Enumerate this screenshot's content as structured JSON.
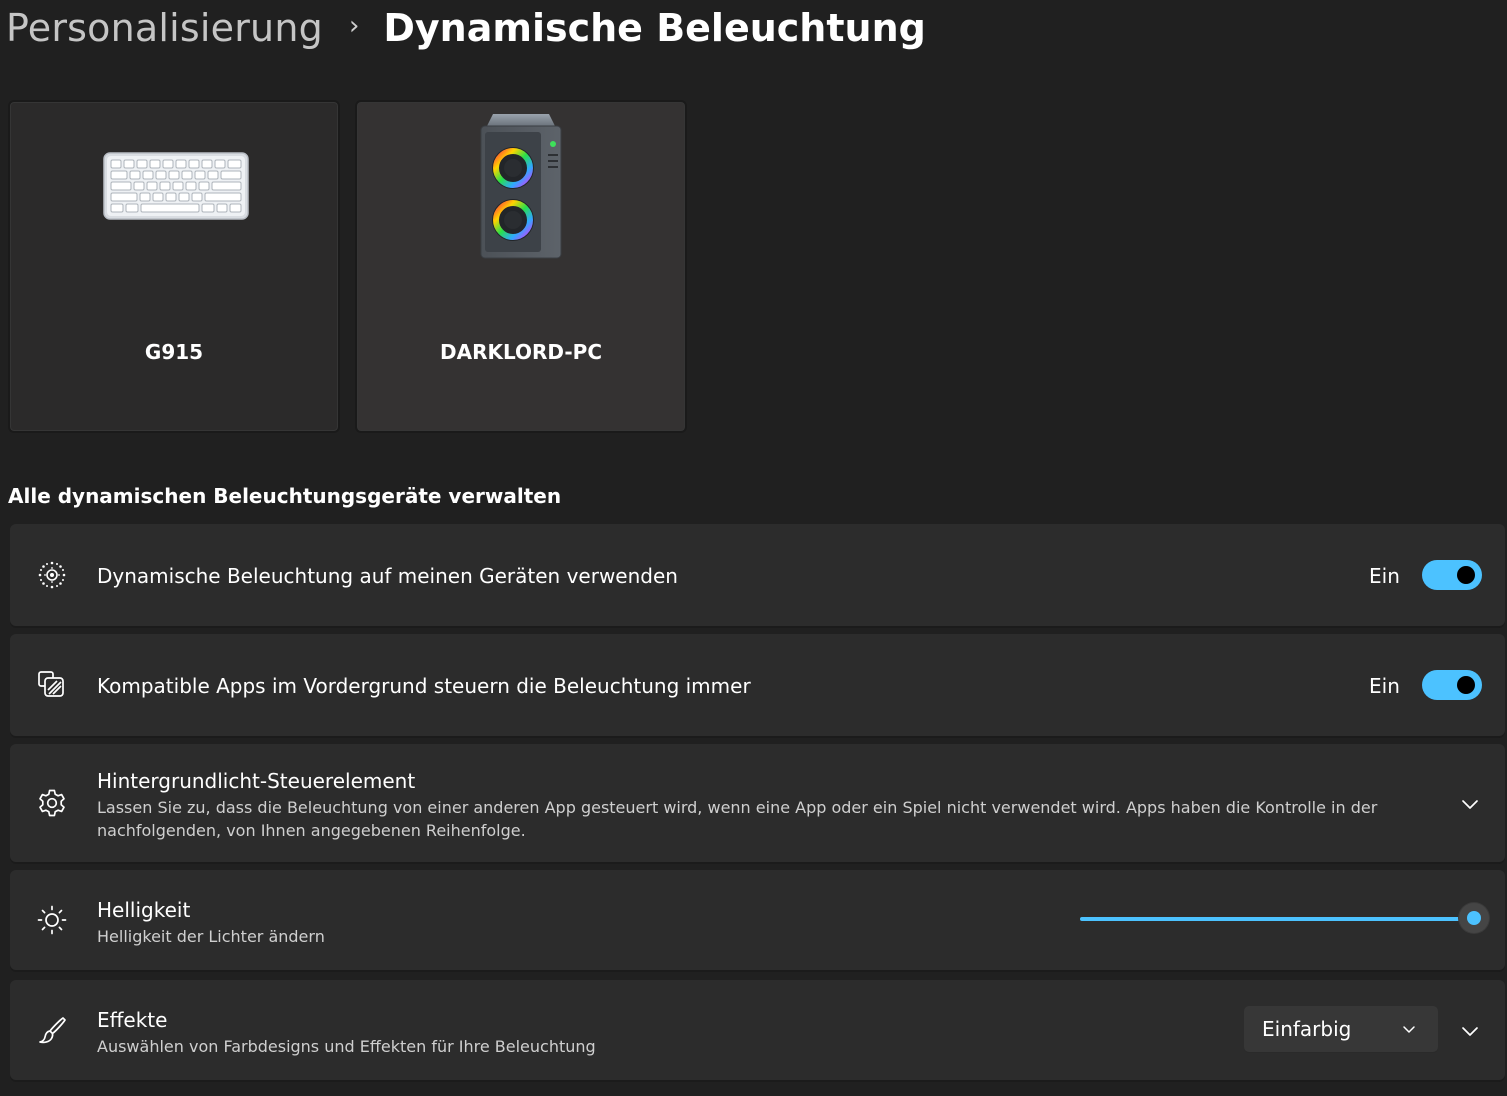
{
  "breadcrumb": {
    "parent": "Personalisierung",
    "separator": "›",
    "current": "Dynamische Beleuchtung"
  },
  "devices": [
    {
      "name": "G915",
      "icon": "keyboard-icon"
    },
    {
      "name": "DARKLORD-PC",
      "icon": "pc-tower-icon"
    }
  ],
  "section": {
    "title": "Alle dynamischen Beleuchtungsgeräte verwalten"
  },
  "settings": {
    "use_dynamic_lighting": {
      "title": "Dynamische Beleuchtung auf meinen Geräten verwenden",
      "state_label": "Ein",
      "icon": "lighting-icon"
    },
    "foreground_apps": {
      "title": "Kompatible Apps im Vordergrund steuern die Beleuchtung immer",
      "state_label": "Ein",
      "icon": "foreground-apps-icon"
    },
    "background_control": {
      "title": "Hintergrundlicht-Steuerelement",
      "description": "Lassen Sie zu, dass die Beleuchtung von einer anderen App gesteuert wird, wenn eine App oder ein Spiel nicht verwendet wird. Apps haben die Kontrolle in der nachfolgenden, von Ihnen angegebenen Reihenfolge.",
      "icon": "gear-icon"
    },
    "brightness": {
      "title": "Helligkeit",
      "description": "Helligkeit der Lichter ändern",
      "value_percent": 100,
      "icon": "sun-icon"
    },
    "effects": {
      "title": "Effekte",
      "description": "Auswählen von Farbdesigns und Effekten für Ihre Beleuchtung",
      "selected": "Einfarbig",
      "icon": "brush-icon"
    }
  },
  "colors": {
    "accent": "#4cc2ff",
    "background": "#202020",
    "card": "#2c2c2c"
  }
}
